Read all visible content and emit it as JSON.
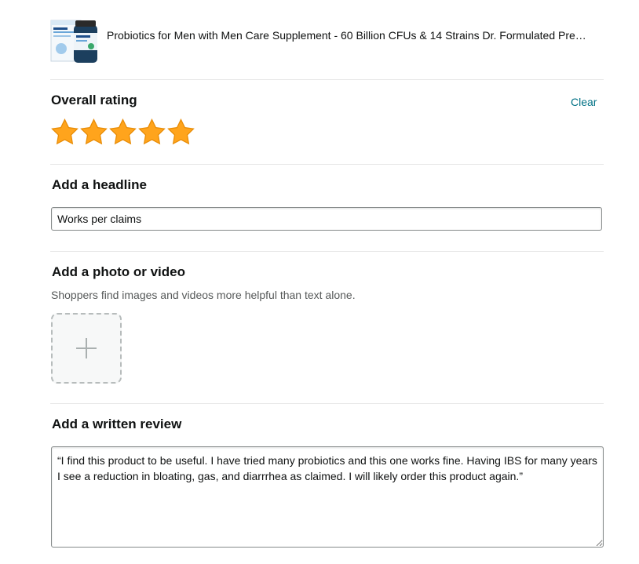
{
  "product": {
    "image_icon": "probiotic-bottle-and-box",
    "title": "Probiotics for Men with Men Care Supplement - 60 Billion CFUs & 14 Strains Dr. Formulated Pre…"
  },
  "rating": {
    "heading": "Overall rating",
    "clear_label": "Clear",
    "stars_selected": 5,
    "stars_total": 5,
    "star_color": "#ffa41c"
  },
  "headline": {
    "heading": "Add a headline",
    "value": "Works per claims"
  },
  "media": {
    "heading": "Add a photo or video",
    "hint": "Shoppers find images and videos more helpful than text alone.",
    "upload_icon": "plus-icon"
  },
  "review": {
    "heading": "Add a written review",
    "value": "“I find this product to be useful. I have tried many probiotics and this one works fine. Having IBS for many years I see a reduction in bloating, gas, and diarrrhea as claimed. I will likely order this product again.”"
  },
  "colors": {
    "link": "#007185",
    "divider": "#e7e7e7",
    "secondary_text": "#565959"
  }
}
